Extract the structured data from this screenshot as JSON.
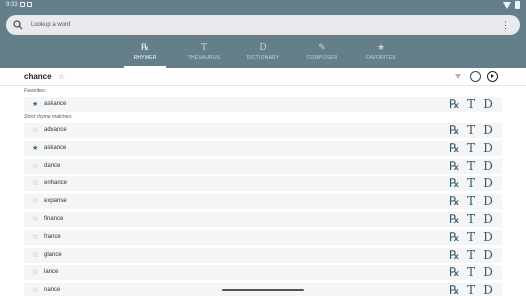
{
  "status": {
    "time": "9:33"
  },
  "search": {
    "placeholder": "Lookup a word",
    "more_glyph": "⋮"
  },
  "tabs": [
    {
      "label": "RHYMER",
      "glyph": "℞",
      "icon": "rhymer-icon",
      "active": true
    },
    {
      "label": "THESAURUS",
      "glyph": "T",
      "icon": "thesaurus-icon",
      "active": false
    },
    {
      "label": "DICTIONARY",
      "glyph": "D",
      "icon": "dictionary-icon",
      "active": false
    },
    {
      "label": "COMPOSER",
      "glyph": "✎",
      "icon": "composer-icon",
      "active": false
    },
    {
      "label": "FAVORITES",
      "glyph": "★",
      "icon": "favorites-icon",
      "active": false
    }
  ],
  "word": {
    "text": "chance",
    "star": "☆"
  },
  "sections": {
    "favorites": "Favorites:",
    "strict": "Strict rhyme matches:"
  },
  "actions": {
    "rhymer": "℞",
    "thesaurus": "T",
    "dictionary": "D"
  },
  "favorites": [
    {
      "word": "askance",
      "favorite": true
    }
  ],
  "matches": [
    {
      "word": "advance",
      "favorite": false
    },
    {
      "word": "askance",
      "favorite": true
    },
    {
      "word": "dance",
      "favorite": false
    },
    {
      "word": "enhance",
      "favorite": false
    },
    {
      "word": "expanse",
      "favorite": false
    },
    {
      "word": "finance",
      "favorite": false
    },
    {
      "word": "france",
      "favorite": false
    },
    {
      "word": "glance",
      "favorite": false
    },
    {
      "word": "lance",
      "favorite": false
    },
    {
      "word": "nance",
      "favorite": false
    }
  ],
  "colors": {
    "appbar": "#657f8a",
    "accent": "#38576a",
    "row_bg": "#f4f5f6"
  }
}
